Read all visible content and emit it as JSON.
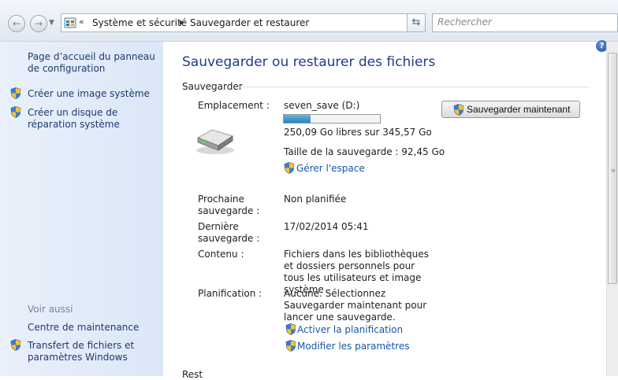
{
  "address_bar": {
    "overflow_chevron": "«",
    "crumbs": [
      "Système et sécurité",
      "Sauvegarder et restaurer"
    ],
    "search_placeholder": "Rechercher"
  },
  "left_pane": {
    "home_link": "Page d’accueil du panneau de configuration",
    "tasks": [
      {
        "label": "Créer une image système",
        "icon": "shield-icon"
      },
      {
        "label": "Créer un disque de réparation système",
        "icon": "shield-icon"
      }
    ],
    "see_also_heading": "Voir aussi",
    "see_also": [
      {
        "label": "Centre de maintenance"
      },
      {
        "label": "Transfert de fichiers et paramètres Windows",
        "icon": "shield-icon"
      }
    ]
  },
  "main": {
    "title": "Sauvegarder ou restaurer des fichiers",
    "section_backup": "Sauvegarder",
    "location_label": "Emplacement :",
    "location_value": "seven_save (D:)",
    "disk_usage_fraction": 0.28,
    "free_space": "250,09 Go libres sur 345,57 Go",
    "backup_size": "Taille de la sauvegarde : 92,45 Go",
    "manage_space_link": "Gérer l'espace",
    "backup_now_button": "Sauvegarder maintenant",
    "next_backup_label": "Prochaine sauvegarde :",
    "next_backup_value": "Non planifiée",
    "last_backup_label": "Dernière sauvegarde :",
    "last_backup_value": "17/02/2014 05:41",
    "contents_label": "Contenu :",
    "contents_value": "Fichiers dans les bibliothèques et dossiers personnels pour tous les utilisateurs et image système",
    "schedule_label": "Planification :",
    "schedule_value": "Aucune. Sélectionnez Sauvegarder maintenant pour lancer une sauvegarde.",
    "activate_schedule_link": "Activer la planification",
    "change_settings_link": "Modifier les paramètres",
    "next_section_partial": "Rest"
  },
  "colors": {
    "link": "#1a55a8",
    "title": "#1e3c8c",
    "left_pane_bg": "#dbe7f7",
    "progress_fill": "#2a7fbe"
  },
  "help_button": "?"
}
